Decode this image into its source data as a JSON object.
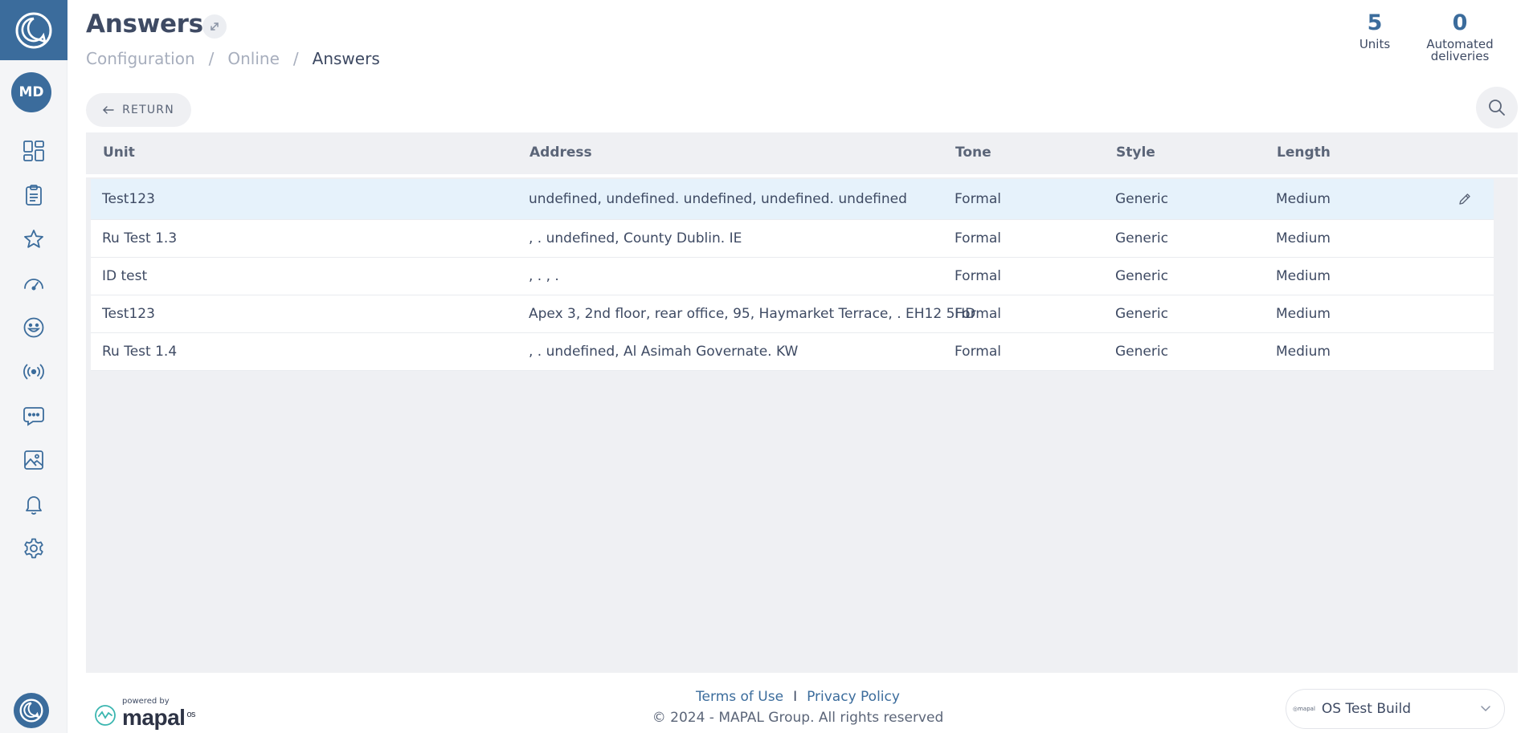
{
  "header": {
    "title": "Answers",
    "breadcrumb": [
      "Configuration",
      "Online",
      "Answers"
    ]
  },
  "stats": [
    {
      "value": "5",
      "label": "Units"
    },
    {
      "value": "0",
      "label_line1": "Automated",
      "label_line2": "deliveries"
    }
  ],
  "user": {
    "initials": "MD"
  },
  "sidebar": {
    "icons": [
      "dashboard-icon",
      "clipboard-icon",
      "star-icon",
      "speedometer-icon",
      "smiley-icon",
      "broadcast-icon",
      "chat-icon",
      "image-icon",
      "bell-icon",
      "gear-icon"
    ]
  },
  "toolbar": {
    "return_label": "RETURN"
  },
  "table": {
    "headers": {
      "unit": "Unit",
      "address": "Address",
      "tone": "Tone",
      "style": "Style",
      "length": "Length"
    },
    "rows": [
      {
        "unit": "Test123",
        "address": "undefined, undefined. undefined, undefined. undefined",
        "tone": "Formal",
        "style": "Generic",
        "length": "Medium"
      },
      {
        "unit": "Ru Test 1.3",
        "address": ", . undefined, County Dublin. IE",
        "tone": "Formal",
        "style": "Generic",
        "length": "Medium"
      },
      {
        "unit": "ID test",
        "address": ", . , .",
        "tone": "Formal",
        "style": "Generic",
        "length": "Medium"
      },
      {
        "unit": "Test123",
        "address": "Apex 3, 2nd floor, rear office, 95, Haymarket Terrace, . EH12 5HD",
        "tone": "Formal",
        "style": "Generic",
        "length": "Medium"
      },
      {
        "unit": "Ru Test 1.4",
        "address": ", . undefined, Al Asimah Governate. KW",
        "tone": "Formal",
        "style": "Generic",
        "length": "Medium"
      }
    ]
  },
  "footer": {
    "powered_by": "powered by",
    "brand": "mapal",
    "brand_suffix": "os",
    "terms": "Terms of Use",
    "separator": "I",
    "privacy": "Privacy Policy",
    "copyright": "© 2024 - MAPAL Group. All rights reserved",
    "build_logo_text": "mapal",
    "build_value": "OS Test Build"
  },
  "colors": {
    "brand": "#3b6c9c",
    "highlight_row": "#e6f2fb",
    "panel": "#eff0f3"
  }
}
